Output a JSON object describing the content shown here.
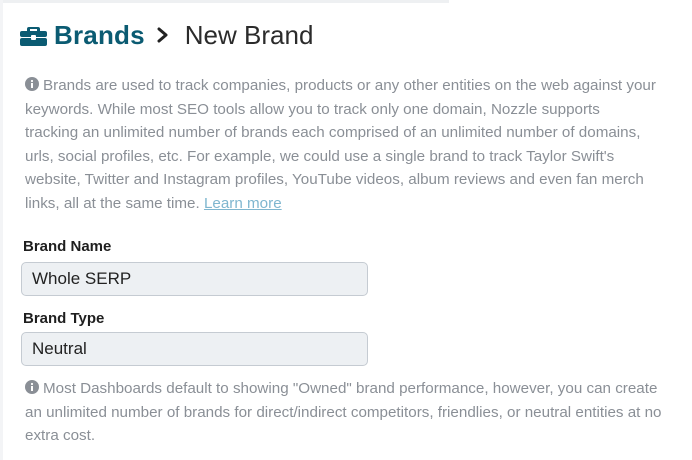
{
  "breadcrumb": {
    "icon": "briefcase-icon",
    "parent": "Brands",
    "separator_icon": "chevron-right-icon",
    "current": "New Brand"
  },
  "intro": {
    "icon": "info-circle-icon",
    "text": "Brands are used to track companies, products or any other entities on the web against your keywords. While most SEO tools allow you to track only one domain, Nozzle supports tracking an unlimited number of brands each comprised of an unlimited number of domains, urls, social profiles, etc. For example, we could use a single brand to track Taylor Swift's website, Twitter and Instagram profiles, YouTube videos, album reviews and even fan merch links, all at the same time.",
    "link": "Learn more"
  },
  "form": {
    "brand_name": {
      "label": "Brand Name",
      "value": "Whole SERP"
    },
    "brand_type": {
      "label": "Brand Type",
      "value": "Neutral"
    }
  },
  "footnote": {
    "icon": "info-circle-icon",
    "text": "Most Dashboards default to showing \"Owned\" brand performance, however, you can create an unlimited number of brands for direct/indirect competitors, friendlies, or neutral entities at no extra cost."
  },
  "colors": {
    "brand_teal": "#0b5b72",
    "muted_text": "#8a8f96",
    "link": "#7fb6cf",
    "field_bg": "#edf0f3"
  }
}
